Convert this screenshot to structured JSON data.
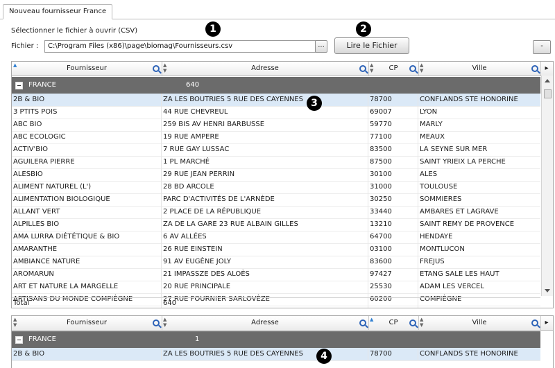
{
  "tab": {
    "label": "Nouveau fournisseur France"
  },
  "file": {
    "prompt": "Sélectionner le fichier à ouvrir (CSV)",
    "label": "Fichier :",
    "path": "C:\\Program Files (x86)\\page\\biomag\\Fournisseurs.csv",
    "browse_label": "...",
    "read_label": "Lire le Fichier",
    "minus_label": "-"
  },
  "markers": [
    "1",
    "2",
    "3",
    "4"
  ],
  "columns": [
    "Fournisseur",
    "Adresse",
    "CP",
    "Ville"
  ],
  "grid1": {
    "group": {
      "name": "FRANCE",
      "count": "640"
    },
    "rows": [
      [
        "2B & BIO",
        "ZA LES BOUTRIES  5 RUE DES CAYENNES",
        "78700",
        "CONFLANDS STE HONORINE"
      ],
      [
        "3 PTITS POIS",
        "44 RUE CHEVREUL",
        "69007",
        "LYON"
      ],
      [
        "ABC BIO",
        "259 BIS AV HENRI BARBUSSE",
        "59770",
        "MARLY"
      ],
      [
        "ABC ECOLOGIC",
        "19 RUE AMPERE",
        "77100",
        "MEAUX"
      ],
      [
        "ACTIV'BIO",
        "7 RUE GAY LUSSAC",
        "83500",
        "LA SEYNE SUR MER"
      ],
      [
        "AGUILERA PIERRE",
        "1 PL MARCHÉ",
        "87500",
        "SAINT YRIEIX LA PERCHE"
      ],
      [
        "ALESBIO",
        "29 RUE JEAN PERRIN",
        "30100",
        "ALES"
      ],
      [
        "ALIMENT NATUREL (L')",
        "28 BD ARCOLE",
        "31000",
        "TOULOUSE"
      ],
      [
        "ALIMENTATION BIOLOGIQUE",
        "PARC D'ACTIVITÉS DE L'ARNÈDE",
        "30250",
        "SOMMIERES"
      ],
      [
        "ALLANT VERT",
        "2 PLACE DE LA RÉPUBLIQUE",
        "33440",
        "AMBARES ET LAGRAVE"
      ],
      [
        "ALPILLES BIO",
        "ZA DE LA GARE  23 RUE ALBAIN GILLES",
        "13210",
        "SAINT REMY DE PROVENCE"
      ],
      [
        "AMA LURRA DIÉTÉTIQUE & BIO",
        "6 AV ALLÉES",
        "64700",
        "HENDAYE"
      ],
      [
        "AMARANTHE",
        "26 RUE EINSTEIN",
        "03100",
        "MONTLUCON"
      ],
      [
        "AMBIANCE NATURE",
        "91 AV EUGÈNE JOLY",
        "83600",
        "FREJUS"
      ],
      [
        "AROMARUN",
        "21 IMPASSZE DES ALOÈS",
        "97427",
        "ETANG SALE LES HAUT"
      ],
      [
        "ART ET NATURE LA MARGELLE",
        "20 RUE PRINCIPALE",
        "25530",
        "ADAM LES VERCEL"
      ],
      [
        "ARTISANS DU MONDE COMPIÈGNE",
        "27 RUE FOURNIER SARLOVÈZE",
        "60200",
        "COMPIÈGNE"
      ]
    ],
    "total_label": "Total",
    "total_value": "640"
  },
  "grid2": {
    "group": {
      "name": "FRANCE",
      "count": "1"
    },
    "rows": [
      [
        "2B & BIO",
        "ZA LES BOUTRIES  5 RUE DES CAYENNES",
        "78700",
        "CONFLANDS STE HONORINE"
      ]
    ]
  },
  "icons": {
    "search": "magnifier-icon",
    "sort": "sort-arrows-icon",
    "collapse": "collapse-minus-icon"
  },
  "colors": {
    "group_bar": "#6b6b6b",
    "selected_row": "#dbe9f7",
    "search_icon": "#2d63b8"
  }
}
